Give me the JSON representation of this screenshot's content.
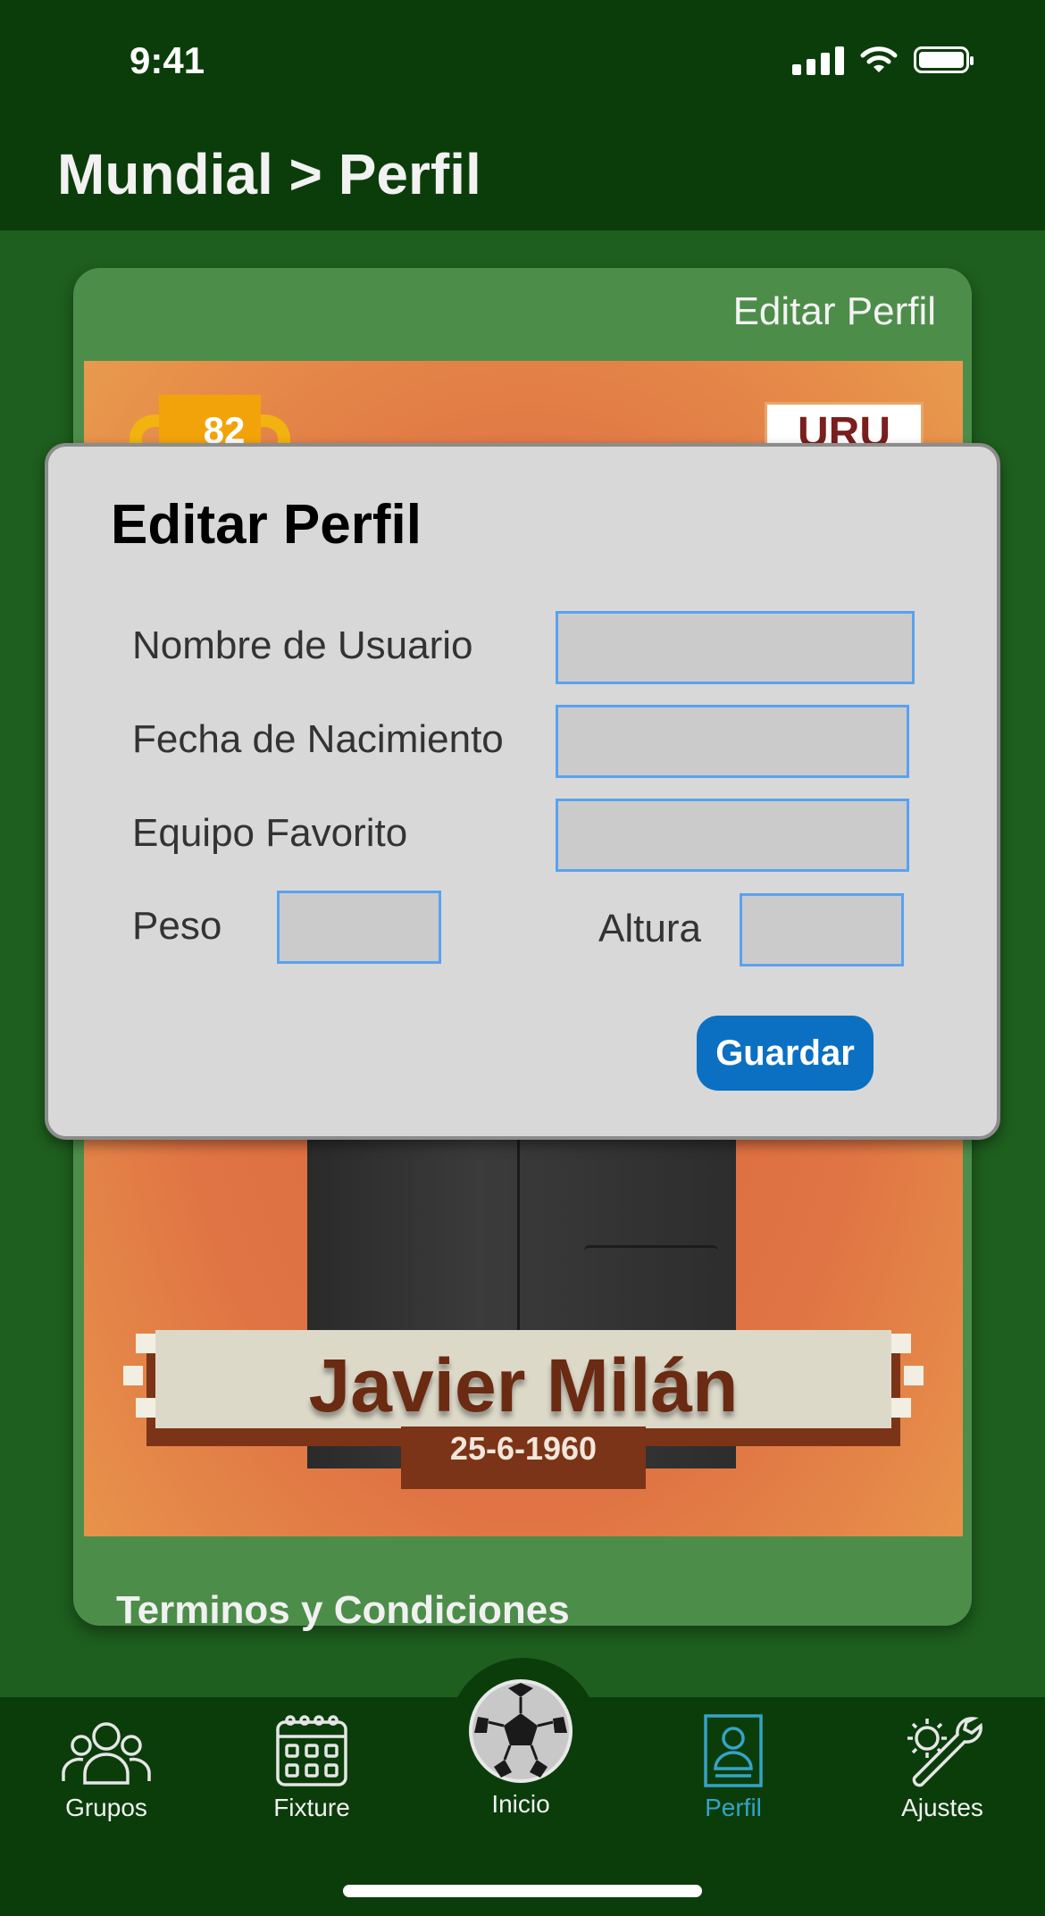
{
  "status_bar": {
    "time": "9:41",
    "icons": [
      "cellular-signal-icon",
      "wifi-icon",
      "battery-icon"
    ]
  },
  "header": {
    "title": "Mundial > Perfil"
  },
  "profile_card": {
    "edit_link": "Editar Perfil",
    "rating": "82",
    "country": "URU",
    "player_name": "Javier Milán",
    "birth_date": "25-6-1960",
    "terms_link": "Terminos y Condiciones"
  },
  "edit_modal": {
    "title": "Editar Perfil",
    "fields": {
      "username": {
        "label": "Nombre de Usuario",
        "value": ""
      },
      "birth_date": {
        "label": "Fecha de Nacimiento",
        "value": ""
      },
      "favorite_team": {
        "label": "Equipo Favorito",
        "value": ""
      },
      "weight": {
        "label": "Peso",
        "value": ""
      },
      "height": {
        "label": "Altura",
        "value": ""
      }
    },
    "save_label": "Guardar"
  },
  "tab_bar": {
    "items": [
      {
        "label": "Grupos",
        "icon": "group-icon",
        "active": false
      },
      {
        "label": "Fixture",
        "icon": "calendar-icon",
        "active": false
      },
      {
        "label": "Inicio",
        "icon": "soccer-ball-icon",
        "active": false
      },
      {
        "label": "Perfil",
        "icon": "profile-card-icon",
        "active": true
      },
      {
        "label": "Ajustes",
        "icon": "tools-icon",
        "active": false
      }
    ]
  },
  "colors": {
    "header_bg": "#0b3d0b",
    "page_bg": "#1e5e1e",
    "card_bg": "#4d8d4a",
    "accent": "#36a3c6",
    "save_button": "#0b70c2",
    "input_border": "#5aa2ee"
  }
}
